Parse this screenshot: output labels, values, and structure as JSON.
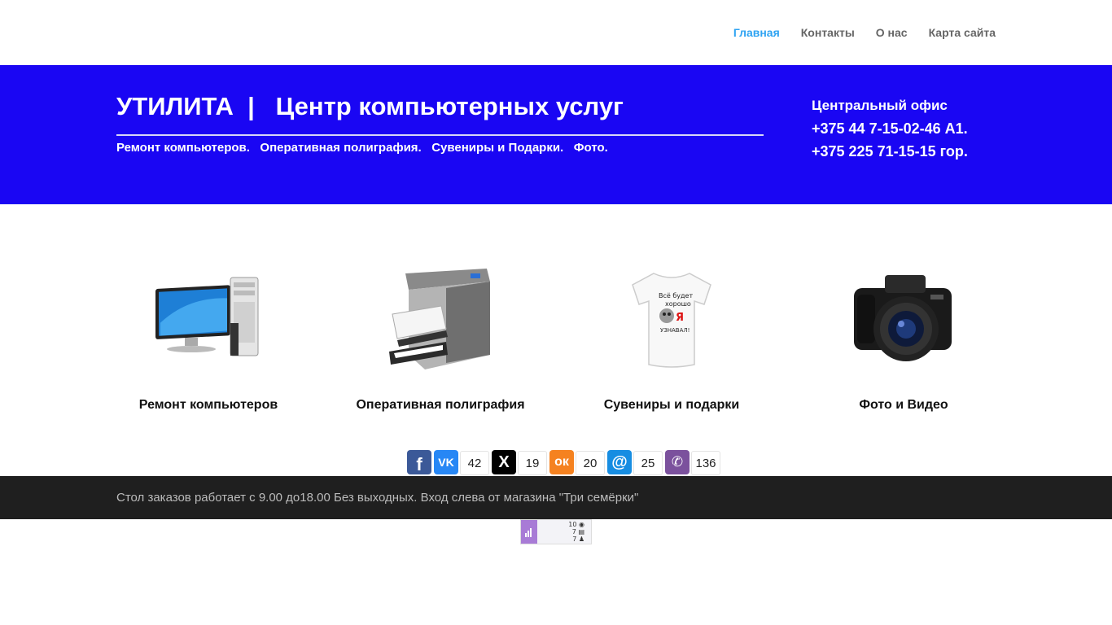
{
  "nav": {
    "items": [
      {
        "label": "Главная",
        "active": true
      },
      {
        "label": "Контакты",
        "active": false
      },
      {
        "label": "О нас",
        "active": false
      },
      {
        "label": "Карта сайта",
        "active": false
      }
    ]
  },
  "header": {
    "title": "УТИЛИТА  |   Центр компьютерных услуг",
    "services_line": "Ремонт компьютеров.   Оперативная полиграфия.   Сувениры и Подарки.   Фото.",
    "office_title": "Центральный офис",
    "phone_1": "+375 44 7-15-02-46 А1.",
    "phone_2": "+375 225 71-15-15 гор."
  },
  "services": [
    {
      "label": "Ремонт компьютеров",
      "icon": "computer-icon"
    },
    {
      "label": "Оперативная полиграфия",
      "icon": "printer-icon"
    },
    {
      "label": "Сувениры и подарки",
      "icon": "tshirt-icon"
    },
    {
      "label": "Фото и Видео",
      "icon": "camera-icon"
    }
  ],
  "tshirt_text": [
    "Всё будет",
    "хорошо",
    "Я",
    "УЗНАВАЛ!"
  ],
  "share": {
    "facebook_count": "",
    "vk_count": "42",
    "x_count": "19",
    "ok_count": "20",
    "mail_count": "25",
    "viber_count": "136"
  },
  "footer": {
    "text": "Стол заказов работает с 9.00 до18.00 Без выходных. Вход слева от магазина \"Три семёрки\""
  },
  "counter": {
    "line1": "10",
    "line2": "7",
    "line3": "7"
  },
  "colors": {
    "header_bg": "#1a06f3",
    "nav_active": "#2ea3f2",
    "footer_bg": "#1f1f1f"
  }
}
